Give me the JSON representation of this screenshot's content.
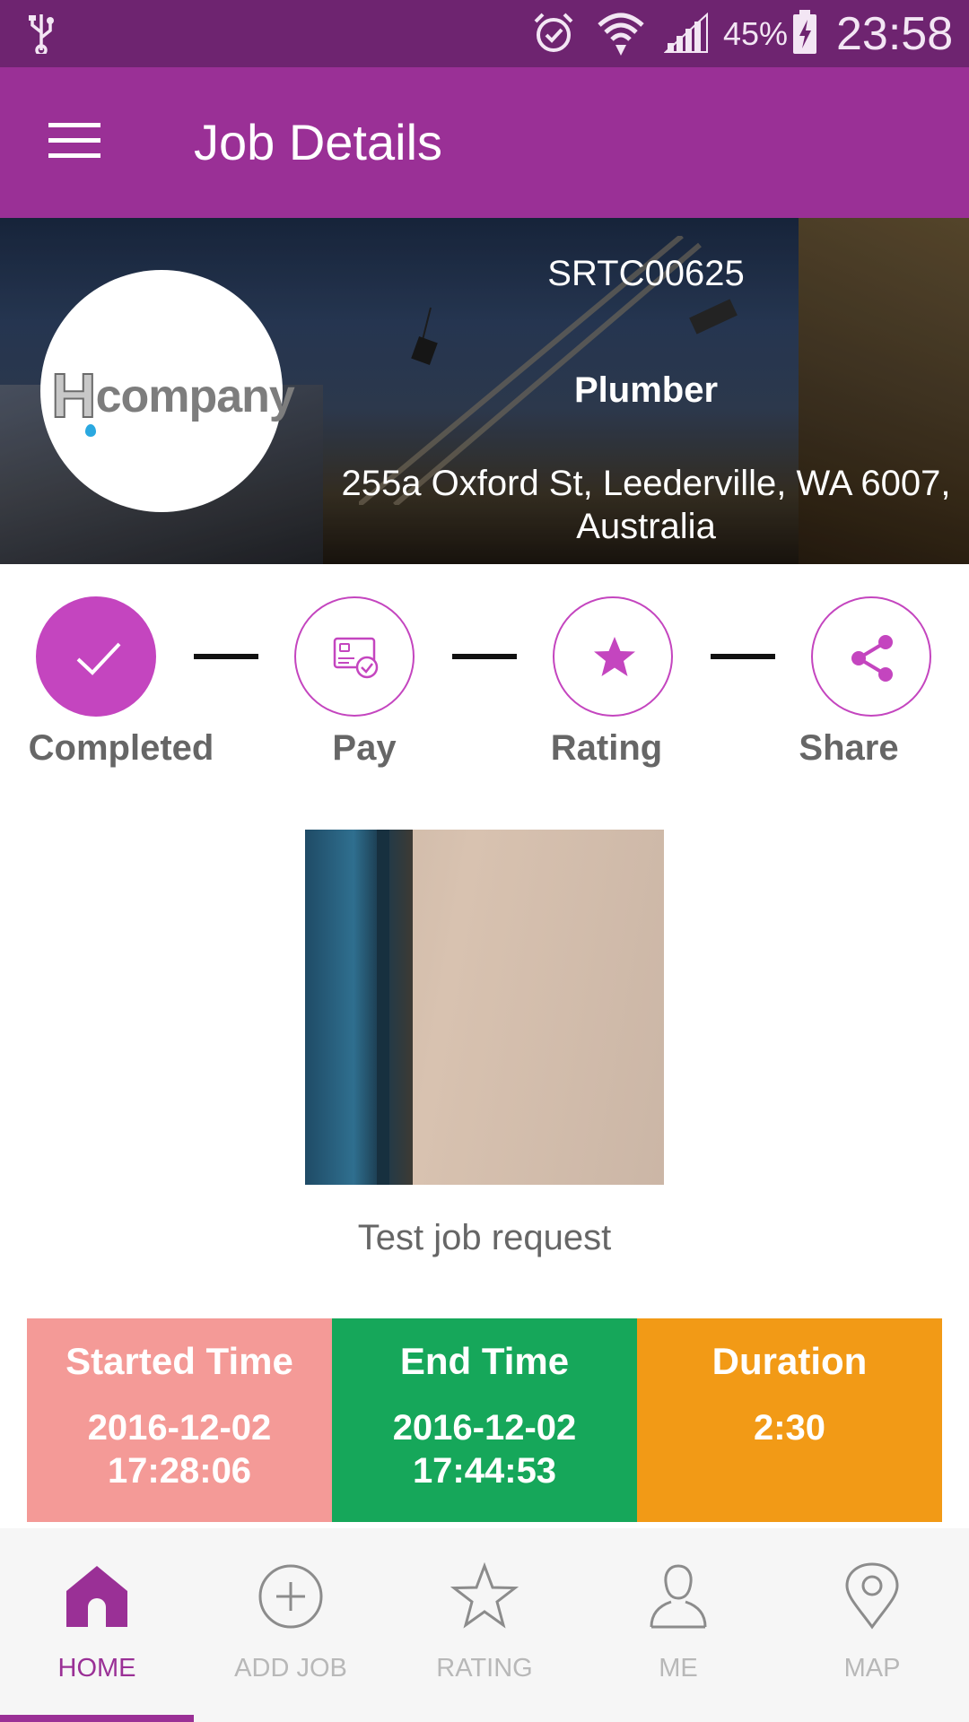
{
  "status_bar": {
    "battery_percent": "45%",
    "time": "23:58",
    "icons": [
      "usb-icon",
      "alarm-icon",
      "wifi-icon",
      "signal-icon",
      "battery-charging-icon"
    ]
  },
  "app_bar": {
    "title": "Job Details",
    "menu_icon": "hamburger-menu-icon"
  },
  "job": {
    "company_logo_text": "company",
    "company_logo_letter": "H",
    "code": "SRTC00625",
    "trade": "Plumber",
    "address": "255a Oxford St, Leederville, WA 6007, Australia",
    "description": "Test job request"
  },
  "steps": [
    {
      "label": "Completed",
      "icon": "check-icon",
      "state": "done"
    },
    {
      "label": "Pay",
      "icon": "payment-card-icon",
      "state": "pending"
    },
    {
      "label": "Rating",
      "icon": "star-icon",
      "state": "pending"
    },
    {
      "label": "Share",
      "icon": "share-icon",
      "state": "pending"
    }
  ],
  "times": {
    "started": {
      "label": "Started Time",
      "date": "2016-12-02",
      "time": "17:28:06",
      "color": "#f49a97"
    },
    "end": {
      "label": "End Time",
      "date": "2016-12-02",
      "time": "17:44:53",
      "color": "#16a75a"
    },
    "duration": {
      "label": "Duration",
      "value": "2:30",
      "color": "#f29a16"
    }
  },
  "bottom_nav": [
    {
      "label": "HOME",
      "icon": "home-icon",
      "active": true
    },
    {
      "label": "ADD JOB",
      "icon": "add-circle-icon",
      "active": false
    },
    {
      "label": "RATING",
      "icon": "star-outline-icon",
      "active": false
    },
    {
      "label": "ME",
      "icon": "person-icon",
      "active": false
    },
    {
      "label": "MAP",
      "icon": "map-pin-icon",
      "active": false
    }
  ],
  "colors": {
    "status_bar": "#6e2470",
    "app_bar": "#9a3096",
    "accent": "#c445bf",
    "nav_active": "#9a3096",
    "nav_inactive": "#b8b8b8"
  }
}
